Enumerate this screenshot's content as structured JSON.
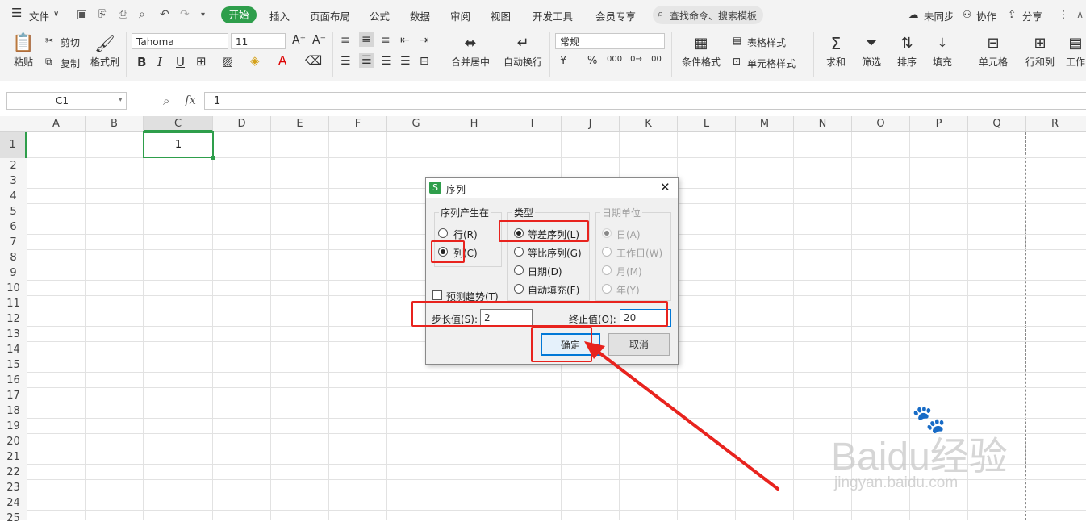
{
  "menubar": {
    "file": "文件",
    "tabs": [
      "开始",
      "插入",
      "页面布局",
      "公式",
      "数据",
      "审阅",
      "视图",
      "开发工具",
      "会员专享"
    ],
    "search": "查找命令、搜索模板",
    "right": [
      "未同步",
      "协作",
      "分享"
    ]
  },
  "ribbon": {
    "paste": "粘贴",
    "cut": "剪切",
    "copy": "复制",
    "format_painter": "格式刷",
    "font_name": "Tahoma",
    "font_size": "11",
    "merge_center": "合并居中",
    "wrap_text": "自动换行",
    "number_format": "常规",
    "cond_format": "条件格式",
    "table_style": "表格样式",
    "cell_style": "单元格样式",
    "sum": "求和",
    "filter": "筛选",
    "sort": "排序",
    "fill": "填充",
    "cell": "单元格",
    "row_col": "行和列",
    "worksheet": "工作"
  },
  "formula_bar": {
    "name_box": "C1",
    "fx": "fx",
    "value": "1"
  },
  "grid": {
    "columns": [
      "A",
      "B",
      "C",
      "D",
      "E",
      "F",
      "G",
      "H",
      "I",
      "J",
      "K",
      "L",
      "M",
      "N",
      "O",
      "P",
      "Q",
      "R"
    ],
    "rows": [
      "1",
      "2",
      "3",
      "4",
      "5",
      "6",
      "7",
      "8",
      "9",
      "10",
      "11",
      "12",
      "13",
      "14",
      "15",
      "16",
      "17",
      "18",
      "19",
      "20",
      "21",
      "22",
      "23",
      "24",
      "25"
    ],
    "c1_value": "1"
  },
  "dialog": {
    "title": "序列",
    "series_in": "序列产生在",
    "row": "行(R)",
    "column": "列(C)",
    "type": "类型",
    "linear": "等差序列(L)",
    "growth": "等比序列(G)",
    "date": "日期(D)",
    "autofill": "自动填充(F)",
    "date_unit": "日期单位",
    "day": "日(A)",
    "weekday": "工作日(W)",
    "month": "月(M)",
    "year": "年(Y)",
    "trend": "预测趋势(T)",
    "step_label": "步长值(S):",
    "step_value": "2",
    "stop_label": "终止值(O):",
    "stop_value": "20",
    "ok": "确定",
    "cancel": "取消"
  },
  "watermark": {
    "brand": "Baidu经验",
    "url": "jingyan.baidu.com"
  },
  "colors": {
    "accent": "#2e9e4b",
    "annotation": "#e8231e"
  }
}
